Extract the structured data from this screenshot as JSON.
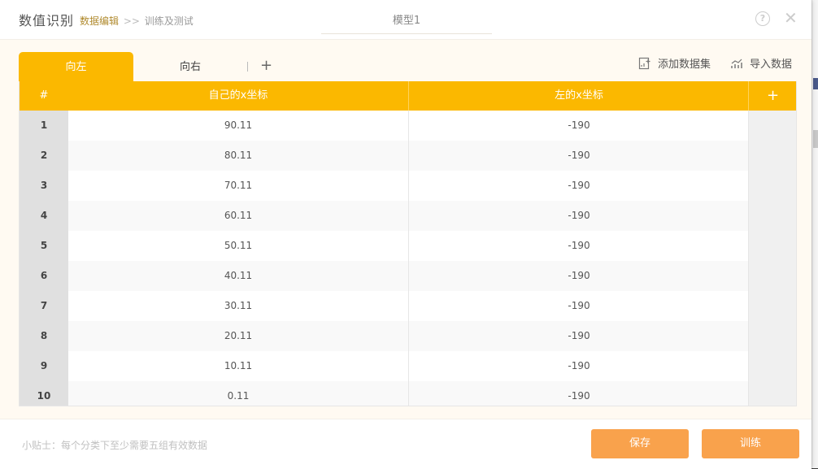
{
  "header": {
    "title": "数值识别",
    "breadcrumb_active": "数据编辑",
    "breadcrumb_sep": ">>",
    "breadcrumb_next": "训练及测试",
    "model_name": "模型1",
    "help_glyph": "?",
    "close_glyph": "✕"
  },
  "tabs": [
    {
      "label": "向左",
      "active": true
    },
    {
      "label": "向右",
      "active": false
    }
  ],
  "tab_add_glyph": "+",
  "actions": {
    "add_dataset": "添加数据集",
    "import_data": "导入数据"
  },
  "table": {
    "headers": {
      "num": "#",
      "col1": "自己的x坐标",
      "col2": "左的x坐标",
      "add": "+"
    },
    "rows": [
      {
        "num": "1",
        "col1": "90.11",
        "col2": "-190"
      },
      {
        "num": "2",
        "col1": "80.11",
        "col2": "-190"
      },
      {
        "num": "3",
        "col1": "70.11",
        "col2": "-190"
      },
      {
        "num": "4",
        "col1": "60.11",
        "col2": "-190"
      },
      {
        "num": "5",
        "col1": "50.11",
        "col2": "-190"
      },
      {
        "num": "6",
        "col1": "40.11",
        "col2": "-190"
      },
      {
        "num": "7",
        "col1": "30.11",
        "col2": "-190"
      },
      {
        "num": "8",
        "col1": "20.11",
        "col2": "-190"
      },
      {
        "num": "9",
        "col1": "10.11",
        "col2": "-190"
      },
      {
        "num": "10",
        "col1": "0.11",
        "col2": "-190"
      }
    ]
  },
  "footer": {
    "tip": "小贴士：每个分类下至少需要五组有效数据",
    "save_label": "保存",
    "train_label": "训练"
  },
  "colors": {
    "accent": "#fbb800",
    "button": "#f9a24c"
  }
}
